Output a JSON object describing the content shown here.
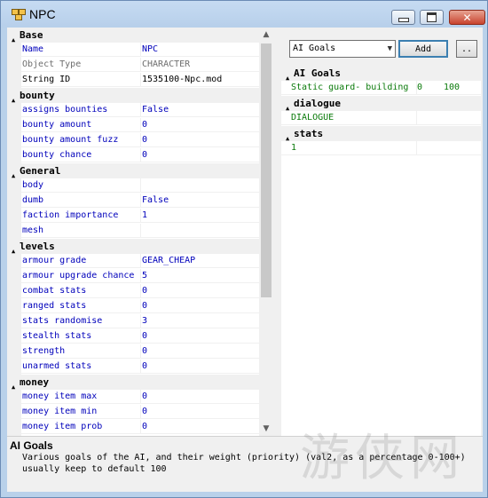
{
  "window": {
    "title": "NPC"
  },
  "grid": {
    "categories": [
      {
        "name": "Base",
        "rows": [
          {
            "label": "Name",
            "value": "NPC",
            "style": "normal"
          },
          {
            "label": "Object Type",
            "value": "CHARACTER",
            "style": "dim"
          },
          {
            "label": "String ID",
            "value": "1535100-Npc.mod",
            "style": "black"
          }
        ]
      },
      {
        "name": "bounty",
        "rows": [
          {
            "label": "assigns bounties",
            "value": "False",
            "style": "normal"
          },
          {
            "label": "bounty amount",
            "value": "0",
            "style": "normal"
          },
          {
            "label": "bounty amount fuzz",
            "value": "0",
            "style": "normal"
          },
          {
            "label": "bounty chance",
            "value": "0",
            "style": "normal"
          }
        ]
      },
      {
        "name": "General",
        "rows": [
          {
            "label": "body",
            "value": "",
            "style": "normal"
          },
          {
            "label": "dumb",
            "value": "False",
            "style": "normal"
          },
          {
            "label": "faction importance",
            "value": "1",
            "style": "normal"
          },
          {
            "label": "mesh",
            "value": "",
            "style": "normal"
          }
        ]
      },
      {
        "name": "levels",
        "rows": [
          {
            "label": "armour grade",
            "value": "GEAR_CHEAP",
            "style": "normal"
          },
          {
            "label": "armour upgrade chance",
            "value": "5",
            "style": "normal"
          },
          {
            "label": "combat stats",
            "value": "0",
            "style": "normal"
          },
          {
            "label": "ranged stats",
            "value": "0",
            "style": "normal"
          },
          {
            "label": "stats randomise",
            "value": "3",
            "style": "normal"
          },
          {
            "label": "stealth stats",
            "value": "0",
            "style": "normal"
          },
          {
            "label": "strength",
            "value": "0",
            "style": "normal"
          },
          {
            "label": "unarmed stats",
            "value": "0",
            "style": "normal"
          }
        ]
      },
      {
        "name": "money",
        "rows": [
          {
            "label": "money item max",
            "value": "0",
            "style": "normal"
          },
          {
            "label": "money item min",
            "value": "0",
            "style": "normal"
          },
          {
            "label": "money item prob",
            "value": "0",
            "style": "normal"
          }
        ]
      }
    ]
  },
  "help": {
    "title": "AI Goals",
    "text": "Various goals of the AI, and their weight (priority) (val2, as a percentage 0-100+)\nusually keep to default 100"
  },
  "right": {
    "select_value": "AI Goals",
    "add_label": "Add",
    "more_label": "..",
    "categories": [
      {
        "name": "AI Goals",
        "rows": [
          {
            "name": "Static guard- building",
            "val1": "0",
            "val2": "100"
          }
        ]
      },
      {
        "name": "dialogue",
        "rows": [
          {
            "name": "DIALOGUE",
            "val1": "",
            "val2": ""
          }
        ]
      },
      {
        "name": "stats",
        "rows": [
          {
            "name": "1",
            "val1": "",
            "val2": ""
          }
        ]
      }
    ]
  },
  "watermark": {
    "text": "游侠网"
  }
}
